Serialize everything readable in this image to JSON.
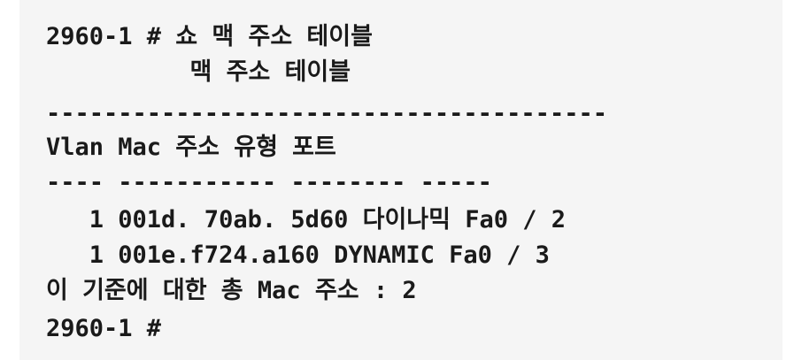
{
  "terminal": {
    "lines": [
      "2960-1 # 쇼 맥 주소 테이블",
      "          맥 주소 테이블",
      "---------------------------------------",
      "Vlan Mac 주소 유형 포트",
      "---- ----------- -------- -----",
      "   1 001d. 70ab. 5d60 다이나믹 Fa0 / 2",
      "   1 001e.f724.a160 DYNAMIC Fa0 / 3",
      "이 기준에 대한 총 Mac 주소 : 2",
      "2960-1 #"
    ]
  }
}
